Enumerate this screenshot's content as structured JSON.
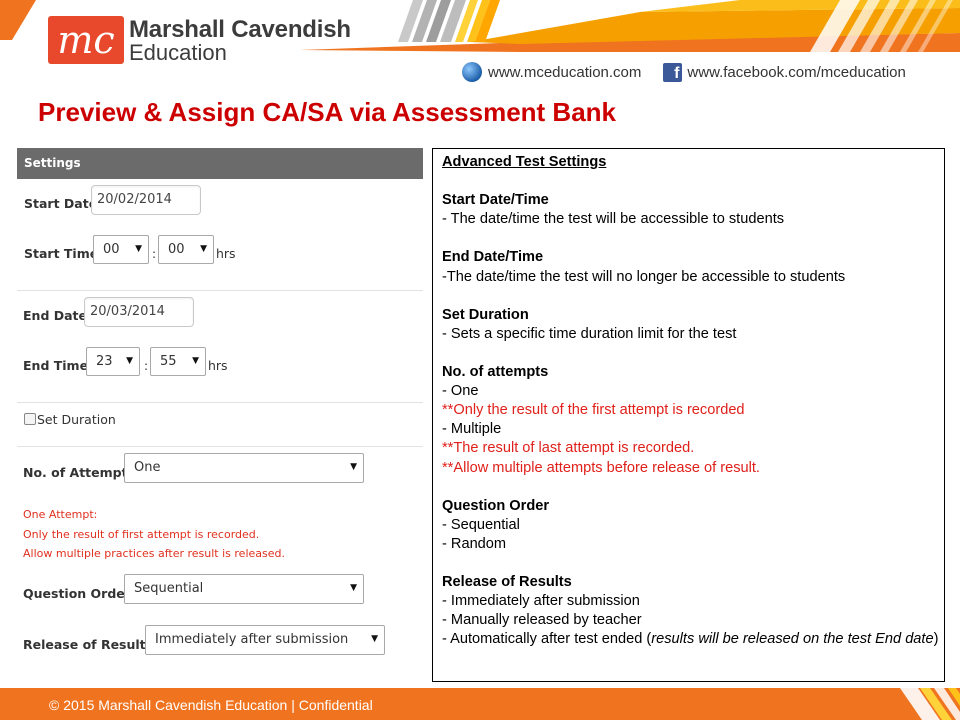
{
  "header": {
    "brand_name": "Marshall Cavendish",
    "brand_sub": "Education",
    "website": "www.mceducation.com",
    "facebook": "www.facebook.com/mceducation",
    "logo_mark": "mc"
  },
  "slide_title": "Preview & Assign CA/SA via Assessment Bank",
  "settings": {
    "header": "Settings",
    "start_date_label": "Start Date:",
    "start_date_value": "20/02/2014",
    "start_time_label": "Start Time:",
    "start_hour": "00",
    "start_minute": "00",
    "colon": ":",
    "hrs": "hrs",
    "end_date_label": "End Date:",
    "end_date_value": "20/03/2014",
    "end_time_label": "End Time:",
    "end_hour": "23",
    "end_minute": "55",
    "set_duration_label": "Set Duration",
    "attempts_label": "No. of Attempts:",
    "attempts_value": "One",
    "attempt_notes": [
      "One Attempt:",
      "Only the result of first attempt is recorded.",
      "Allow multiple practices after result is released."
    ],
    "question_order_label": "Question Order:",
    "question_order_value": "Sequential",
    "release_label": "Release of Results:",
    "release_value": "Immediately after submission"
  },
  "info": {
    "title": "Advanced Test Settings",
    "start_heading": "Start Date/Time",
    "start_desc": "- The date/time the test will be accessible to students",
    "end_heading": "End Date/Time",
    "end_desc": "-The date/time the test will no longer be accessible to students",
    "duration_heading": "Set Duration",
    "duration_desc": "- Sets a specific time duration limit for the test",
    "attempts_heading": "No. of attempts",
    "attempts_one": "- One",
    "attempts_one_note": "**Only the result of the first attempt is recorded",
    "attempts_multiple": "- Multiple",
    "attempts_multi_note1": "**The result of last attempt is recorded.",
    "attempts_multi_note2": "**Allow multiple attempts before release of result.",
    "order_heading": "Question Order",
    "order_seq": "- Sequential",
    "order_random": "- Random",
    "release_heading": "Release of Results",
    "release_immediate": "- Immediately after submission",
    "release_manual": "- Manually released by teacher",
    "release_auto_prefix": "- Automatically after test ended (",
    "release_auto_italic": "results will be released on the test End date",
    "release_auto_suffix": ")"
  },
  "footer": {
    "text": "© 2015 Marshall Cavendish Education | Confidential"
  },
  "colors": {
    "brand_orange": "#f07420",
    "title_red": "#cc0000",
    "note_red": "#e0301e",
    "logo_red": "#e8482c",
    "settings_header_grey": "#6b6b6b"
  },
  "icons": [
    "globe-icon",
    "facebook-icon",
    "dropdown-arrow-icon",
    "checkbox-icon"
  ]
}
